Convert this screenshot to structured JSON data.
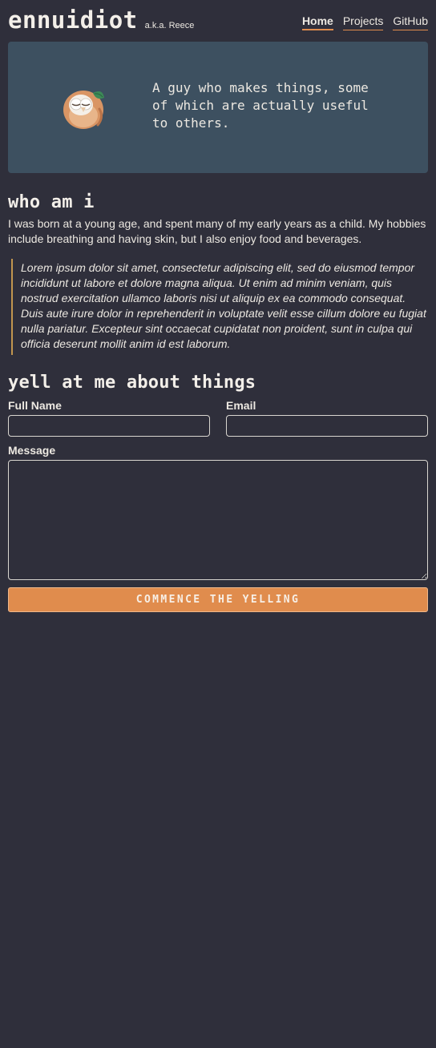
{
  "header": {
    "title": "ennuidiot",
    "aka": "a.k.a. Reece",
    "nav": [
      {
        "label": "Home",
        "active": true
      },
      {
        "label": "Projects",
        "active": false
      },
      {
        "label": "GitHub",
        "active": false
      }
    ]
  },
  "hero": {
    "avatar_icon": "owl-avatar-icon",
    "tagline": "A guy who makes things, some of which are actually useful to others."
  },
  "about": {
    "heading": "who am i",
    "text": "I was born at a young age, and spent many of my early years as a child. My hobbies include breathing and having skin, but I also enjoy food and beverages.",
    "quote": "Lorem ipsum dolor sit amet, consectetur adipiscing elit, sed do eiusmod tempor incididunt ut labore et dolore magna aliqua. Ut enim ad minim veniam, quis nostrud exercitation ullamco laboris nisi ut aliquip ex ea commodo consequat. Duis aute irure dolor in reprehenderit in voluptate velit esse cillum dolore eu fugiat nulla pariatur. Excepteur sint occaecat cupidatat non proident, sunt in culpa qui officia deserunt mollit anim id est laborum."
  },
  "contact": {
    "heading": "yell at me about things",
    "full_name_label": "Full Name",
    "full_name_value": "",
    "email_label": "Email",
    "email_value": "",
    "message_label": "Message",
    "message_value": "",
    "submit_label": "COMMENCE THE YELLING"
  },
  "colors": {
    "background": "#2f2f3b",
    "hero_bg": "#3d5060",
    "accent": "#e08c4d",
    "quote_border": "#c2964f",
    "text": "#ece8e1"
  }
}
